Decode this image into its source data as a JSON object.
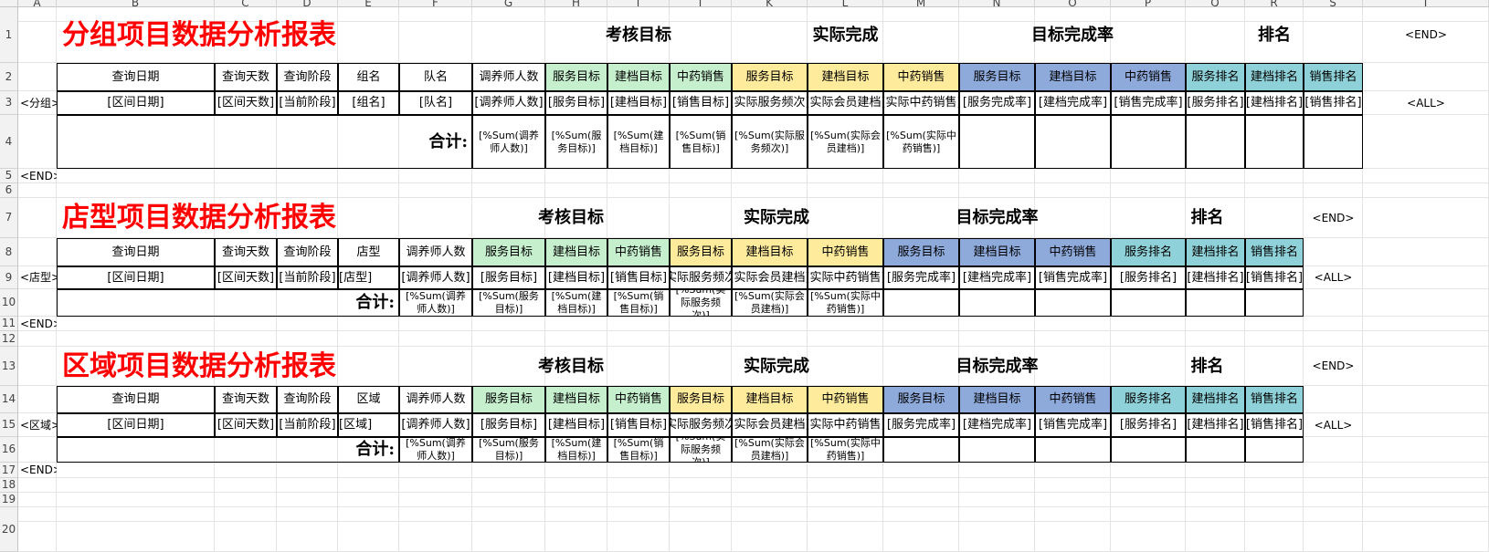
{
  "column_headers": [
    "A",
    "B",
    "C",
    "D",
    "E",
    "F",
    "G",
    "H",
    "I",
    "J",
    "K",
    "L",
    "M",
    "N",
    "O",
    "P",
    "Q",
    "R",
    "S",
    "T"
  ],
  "row_headers": [
    "1",
    "2",
    "3",
    "4",
    "5",
    "6",
    "7",
    "8",
    "9",
    "10",
    "11",
    "12",
    "13",
    "14",
    "15",
    "16",
    "17",
    "18",
    "19",
    "20"
  ],
  "colors": {
    "green": "#c6efce",
    "yellow": "#ffeb9c",
    "blue": "#8eaadb",
    "teal": "#8fd1d8",
    "title_red": "#ff0000"
  },
  "tags": {
    "end": "<END>",
    "all": "<ALL>",
    "group": "<分组>",
    "shop": "<店型>",
    "region": "<区域>"
  },
  "common": {
    "query_date": "查询日期",
    "query_days": "查询天数",
    "query_stage": "查询阶段",
    "coach_count": "调养师人数",
    "svc_target": "服务目标",
    "file_target": "建档目标",
    "tcm_sales": "中药销售",
    "svc_rank": "服务排名",
    "file_rank": "建档排名",
    "sales_rank": "销售排名",
    "sect_target": "考核目标",
    "sect_actual": "实际完成",
    "sect_rate": "目标完成率",
    "sect_rank": "排名",
    "total": "合计:",
    "v_date": "[区间日期]",
    "v_days": "[区间天数]",
    "v_stage": "[当前阶段]",
    "v_coach": "[调养师人数]",
    "v_svc_target": "[服务目标]",
    "v_file_target": "[建档目标]",
    "v_sales_target": "[销售目标]",
    "v_actual_svc": "[实际服务频次]",
    "v_actual_member": "[实际会员建档]",
    "v_actual_tcm": "[实际中药销售]",
    "v_svc_rate": "[服务完成率]",
    "v_file_rate": "[建档完成率]",
    "v_sales_rate": "[销售完成率]",
    "v_svc_rank": "[服务排名]",
    "v_file_rank": "[建档排名]",
    "v_sales_rank": "[销售排名]",
    "s_coach": "[%Sum(调养师人数)]",
    "s_svc": "[%Sum(服务目标)]",
    "s_file": "[%Sum(建档目标)]",
    "s_sales": "[%Sum(销售目标)]",
    "s_actual_svc": "[%Sum(实际服务频次)]",
    "s_actual_member": "[%Sum(实际会员建档)]",
    "s_actual_tcm": "[%Sum(实际中药销售)]"
  },
  "report1": {
    "title": "分组项目数据分析报表",
    "group_label": "组名",
    "team_label": "队名",
    "v_group": "[组名]",
    "v_team": "[队名]"
  },
  "report2": {
    "title": "店型项目数据分析报表",
    "shop_label": "店型",
    "v_shop": "[店型]"
  },
  "report3": {
    "title": "区域项目数据分析报表",
    "region_label": "区域",
    "v_region": "[区域]"
  }
}
